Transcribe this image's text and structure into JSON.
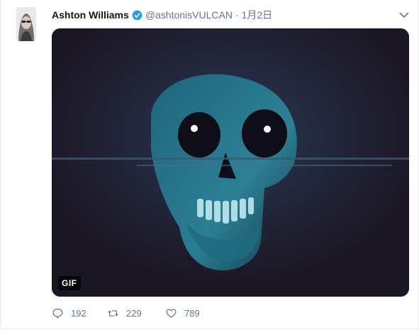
{
  "tweet": {
    "author_name": "Ashton Williams",
    "handle": "@ashtonisVULCAN",
    "separator": "·",
    "timestamp": "1月2日",
    "media": {
      "badge": "GIF",
      "description_icon": "skull-image"
    },
    "stats": {
      "replies": "192",
      "retweets": "229",
      "likes": "789"
    }
  },
  "icons": {
    "verified": "verified-badge-icon",
    "caret": "chevron-down-icon",
    "reply": "reply-icon",
    "retweet": "retweet-icon",
    "like": "heart-icon"
  },
  "colors": {
    "verified_blue": "#1da1f2",
    "muted_text": "#657786",
    "skull_glow": "#4fc6d6",
    "media_bg": "#1b1624"
  }
}
